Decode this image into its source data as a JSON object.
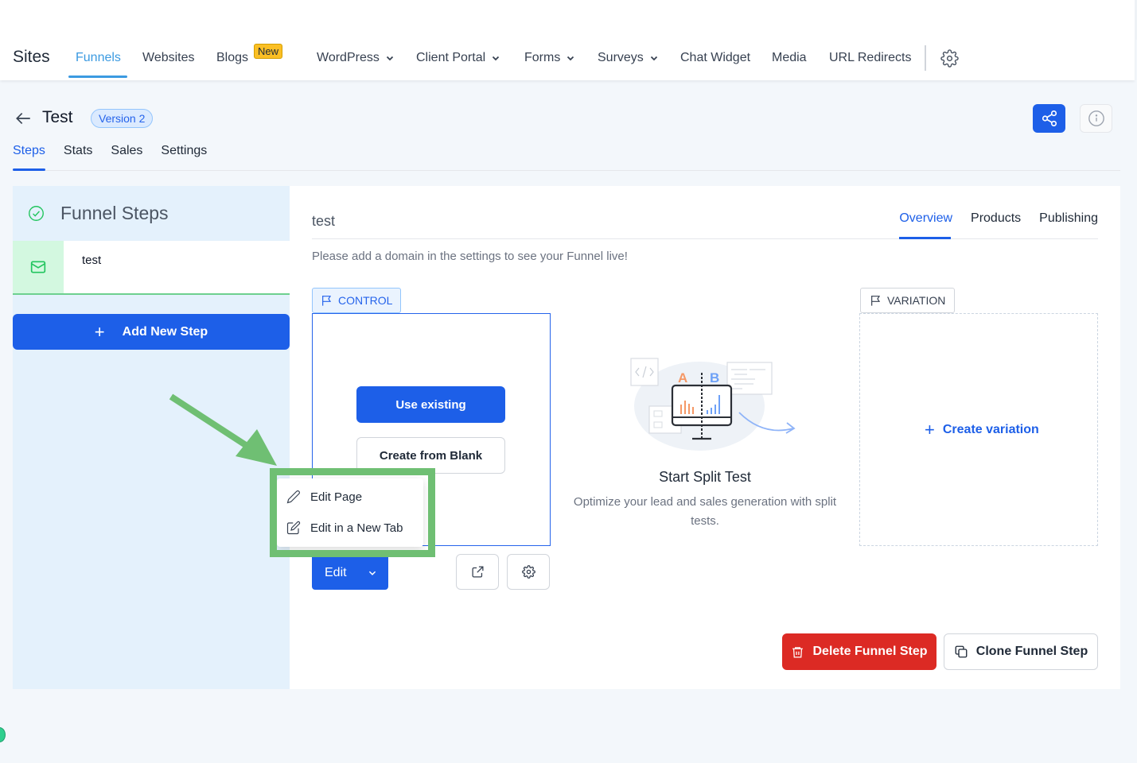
{
  "topnav": {
    "brand": "Sites",
    "items": [
      {
        "label": "Funnels",
        "active": true
      },
      {
        "label": "Websites"
      },
      {
        "label": "Blogs",
        "badge": "New"
      },
      {
        "label": "WordPress",
        "dropdown": true
      },
      {
        "label": "Client Portal",
        "dropdown": true
      },
      {
        "label": "Forms",
        "dropdown": true
      },
      {
        "label": "Surveys",
        "dropdown": true
      },
      {
        "label": "Chat Widget"
      },
      {
        "label": "Media"
      },
      {
        "label": "URL Redirects"
      }
    ],
    "settings_icon": "gear-icon"
  },
  "header": {
    "title": "Test",
    "version_badge": "Version 2",
    "tabs": [
      {
        "label": "Steps",
        "active": true
      },
      {
        "label": "Stats"
      },
      {
        "label": "Sales"
      },
      {
        "label": "Settings"
      }
    ],
    "share_icon": "share-icon",
    "info_icon": "info-icon"
  },
  "sidebar": {
    "title": "Funnel Steps",
    "steps": [
      {
        "name": "test",
        "icon": "mail-icon"
      }
    ],
    "add_step_label": "Add New Step"
  },
  "main": {
    "step_title": "test",
    "tabs": [
      {
        "label": "Overview",
        "active": true
      },
      {
        "label": "Products"
      },
      {
        "label": "Publishing"
      }
    ],
    "domain_message": "Please add a domain in the settings to see your Funnel live!",
    "control": {
      "tag": "CONTROL",
      "use_existing_label": "Use existing",
      "create_blank_label": "Create from Blank",
      "edit_label": "Edit"
    },
    "split_test": {
      "title": "Start Split Test",
      "description": "Optimize your lead and sales generation with split tests.",
      "label_a": "A",
      "label_b": "B"
    },
    "variation": {
      "tag": "VARIATION",
      "create_label": "Create variation"
    },
    "delete_label": "Delete Funnel Step",
    "clone_label": "Clone Funnel Step"
  },
  "edit_menu": {
    "items": [
      {
        "label": "Edit Page",
        "icon": "pencil-icon"
      },
      {
        "label": "Edit in a New Tab",
        "icon": "edit-square-icon"
      }
    ]
  },
  "colors": {
    "primary": "#1d5fe8",
    "nav_active": "#3b9ae1",
    "danger": "#dc2a24",
    "success": "#6ed08f",
    "annotation": "#6fbf73",
    "badge_new": "#fbbf24"
  }
}
